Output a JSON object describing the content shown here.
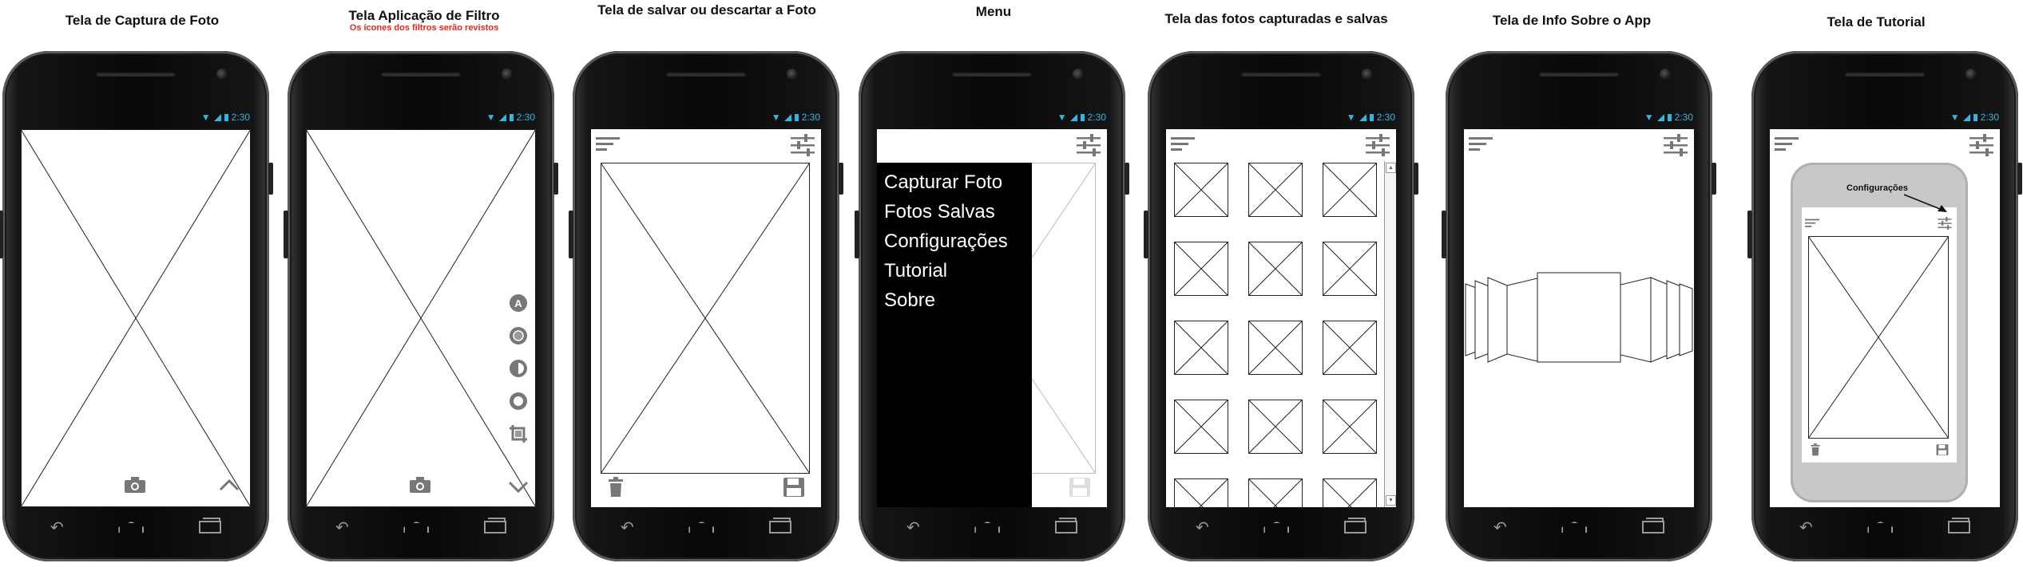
{
  "screens": [
    {
      "title": "Tela de Captura de Foto",
      "subtitle": ""
    },
    {
      "title": "Tela Aplicação de Filtro",
      "subtitle": "Os ícones dos filtros serão revistos"
    },
    {
      "title": "Tela de salvar ou descartar a Foto",
      "subtitle": ""
    },
    {
      "title": "Menu",
      "subtitle": ""
    },
    {
      "title": "Tela das fotos capturadas e salvas",
      "subtitle": ""
    },
    {
      "title": "Tela de Info Sobre o App",
      "subtitle": ""
    },
    {
      "title": "Tela de Tutorial",
      "subtitle": ""
    }
  ],
  "status": {
    "time": "2:30"
  },
  "menu": {
    "items": [
      "Capturar Foto",
      "Fotos Salvas",
      "Configurações",
      "Tutorial",
      "Sobre"
    ]
  },
  "tutorial": {
    "callout": "Configurações"
  },
  "icons": {
    "camera": "camera-icon",
    "chevron_up": "chevron-up-icon",
    "chevron_down": "chevron-down-icon",
    "hamburger": "hamburger-menu-icon",
    "settings": "sliders-settings-icon",
    "trash": "trash-icon",
    "save": "floppy-save-icon",
    "filter_auto": "auto-filter-icon",
    "filter_brightness": "brightness-icon",
    "filter_contrast": "contrast-icon",
    "filter_exposure": "exposure-icon",
    "crop": "crop-icon"
  },
  "colors": {
    "status": "#35b5e5",
    "subtitle": "#e8261f",
    "phone": "#080808"
  }
}
